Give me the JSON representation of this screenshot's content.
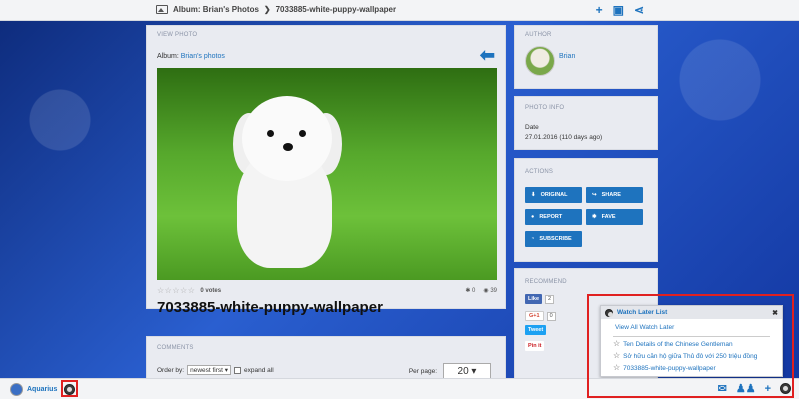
{
  "topbar": {
    "album_label": "Album: Brian's Photos",
    "photo_name": "7033885-white-puppy-wallpaper"
  },
  "main": {
    "section_title": "VIEW PHOTO",
    "album_prefix": "Album:",
    "album_link": "Brian's photos",
    "votes": "0 votes",
    "favorites_count": "0",
    "views_count": "39",
    "photo_title": "7033885-white-puppy-wallpaper"
  },
  "comments": {
    "title": "COMMENTS",
    "order_label": "Order by:",
    "order_value": "newest first",
    "expand_label": "expand all",
    "perpage_label": "Per page:",
    "perpage_value": "20"
  },
  "author": {
    "title": "AUTHOR",
    "name": "Brian"
  },
  "photo_info": {
    "title": "PHOTO INFO",
    "date_label": "Date",
    "date_value": "27.01.2016 (110 days ago)"
  },
  "actions": {
    "title": "ACTIONS",
    "original": "ORIGINAL",
    "share": "SHARE",
    "report": "REPORT",
    "fave": "FAVE",
    "subscribe": "SUBSCRIBE"
  },
  "recommend": {
    "title": "RECOMMEND",
    "fb_like": "Like",
    "fb_count": "2",
    "gplus": "G+1",
    "gplus_count": "0",
    "tweet": "Tweet",
    "pinit": "Pin it"
  },
  "watch_later": {
    "title": "Watch Later List",
    "view_all": "View All Watch Later",
    "items": [
      "Ten Details of the Chinese Gentleman",
      "Sở hữu căn hộ giữa Thủ đô với 250 triệu đồng",
      "7033885-white-puppy-wallpaper"
    ]
  },
  "bottombar": {
    "username": "Aquarius"
  },
  "colors": {
    "accent": "#1e73be",
    "highlight": "#e02020"
  }
}
